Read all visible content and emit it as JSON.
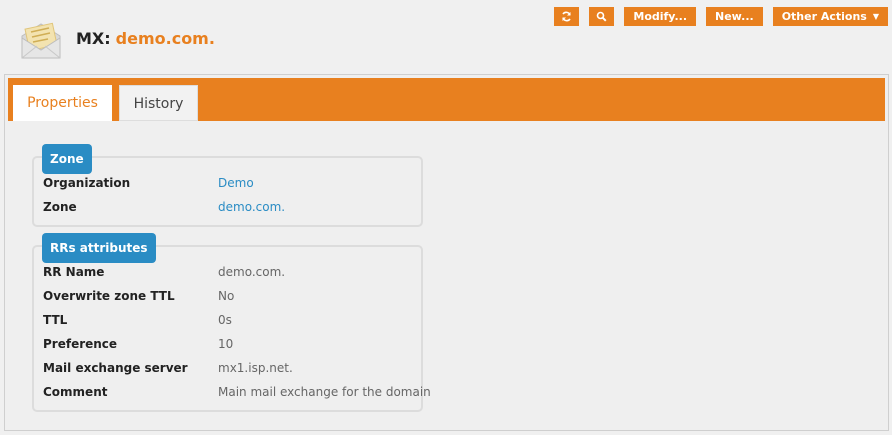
{
  "header": {
    "record_type": "MX:",
    "record_name": "demo.com.",
    "icon": "envelope-icon"
  },
  "toolbar": {
    "refresh_icon": "refresh-icon",
    "search_icon": "search-icon",
    "modify_label": "Modify...",
    "new_label": "New...",
    "other_actions_label": "Other Actions",
    "accent_color": "#e8801f"
  },
  "tabs": [
    {
      "label": "Properties",
      "active": true
    },
    {
      "label": "History",
      "active": false
    }
  ],
  "zone": {
    "title": "Zone",
    "rows": [
      {
        "label": "Organization",
        "value": "Demo"
      },
      {
        "label": "Zone",
        "value": "demo.com."
      }
    ]
  },
  "rrs": {
    "title": "RRs attributes",
    "rows": [
      {
        "label": "RR Name",
        "value": "demo.com."
      },
      {
        "label": "Overwrite zone TTL",
        "value": "No"
      },
      {
        "label": "TTL",
        "value": "0s"
      },
      {
        "label": "Preference",
        "value": "10"
      },
      {
        "label": "Mail exchange server",
        "value": "mx1.isp.net."
      },
      {
        "label": "Comment",
        "value": "Main mail exchange for the domain"
      }
    ]
  }
}
